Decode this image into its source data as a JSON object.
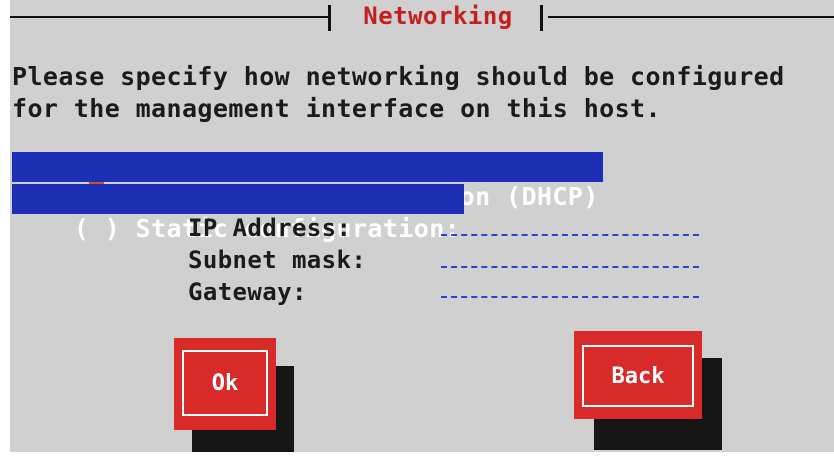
{
  "dialog": {
    "title": "Networking",
    "prompt_line1": "Please specify how networking should be configured",
    "prompt_line2": "for the management interface on this host."
  },
  "options": {
    "automatic": {
      "open": "(",
      "mark": "*",
      "label": ") Automatic configuration (DHCP)",
      "selected": true
    },
    "static": {
      "open": "(",
      "mark": " ",
      "label": ") Static configuration:",
      "selected": false
    }
  },
  "fields": {
    "ip_address": {
      "label": "IP Address:",
      "value": ""
    },
    "subnet_mask": {
      "label": "Subnet mask:",
      "value": ""
    },
    "gateway": {
      "label": "Gateway:",
      "value": ""
    }
  },
  "buttons": {
    "ok_label": "Ok",
    "back_label": "Back"
  },
  "colors": {
    "background": "#cfd0cf",
    "title": "#c41f1f",
    "highlight": "#1c2fb5",
    "button": "#d92a2a",
    "radio_mark": "#c9541e"
  }
}
